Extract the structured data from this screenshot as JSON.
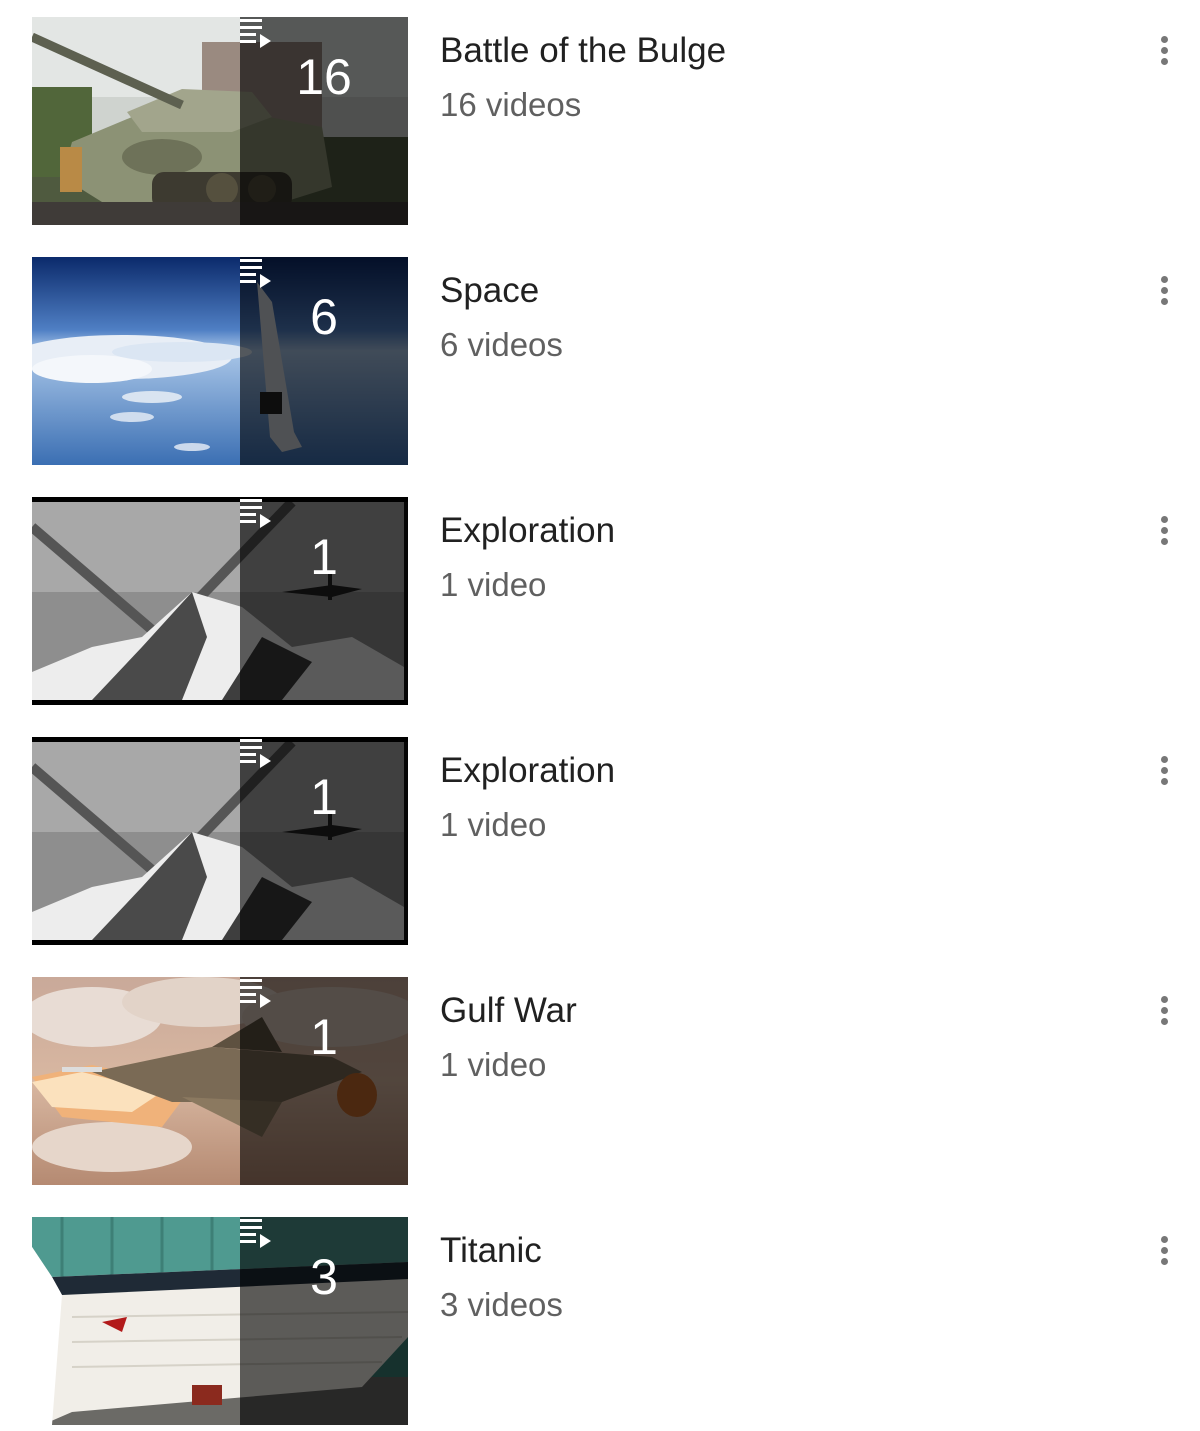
{
  "playlists": [
    {
      "title": "Battle of the Bulge",
      "count": "16",
      "subtitle": "16 videos"
    },
    {
      "title": "Space",
      "count": "6",
      "subtitle": "6 videos"
    },
    {
      "title": "Exploration",
      "count": "1",
      "subtitle": "1 video"
    },
    {
      "title": "Exploration",
      "count": "1",
      "subtitle": "1 video"
    },
    {
      "title": "Gulf War",
      "count": "1",
      "subtitle": "1 video"
    },
    {
      "title": "Titanic",
      "count": "3",
      "subtitle": "3 videos"
    }
  ],
  "icons": {
    "playlist": "playlist-play-icon",
    "more": "more-vertical-icon"
  },
  "colors": {
    "title": "#212121",
    "subtitle": "#606060",
    "overlay": "rgba(0,0,0,0.62)",
    "more_dots": "#777777"
  }
}
